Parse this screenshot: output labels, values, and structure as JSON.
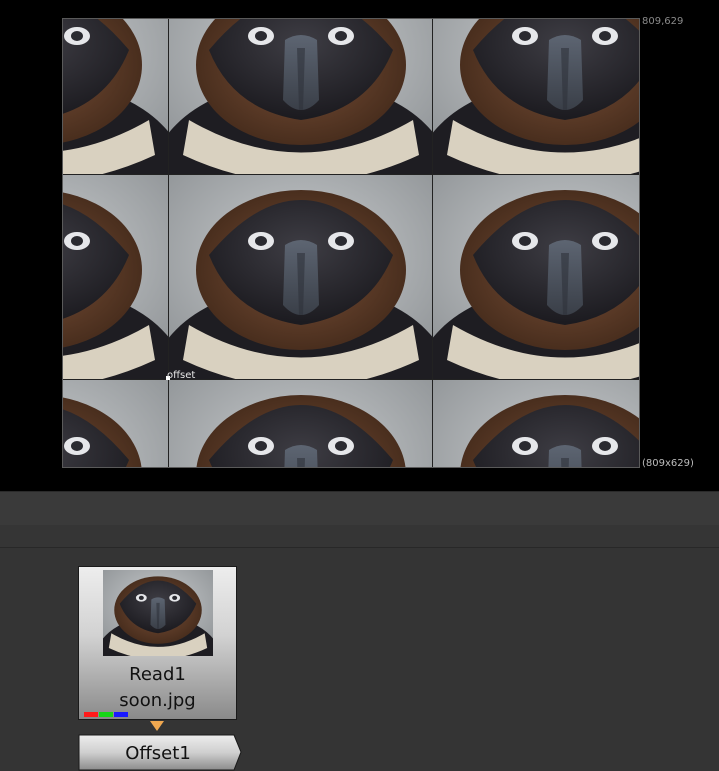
{
  "viewer": {
    "format_coords": "809,629",
    "format_size": "(809x629)",
    "overlay_label": "offset"
  },
  "node_graph": {
    "nodes": [
      {
        "name": "Read1",
        "file": "soon.jpg",
        "channels": {
          "red": "#ff1a1a",
          "green": "#17d617",
          "blue": "#1a1aff"
        }
      },
      {
        "name": "Offset1"
      }
    ],
    "pipe_arrow_color": "#f0a850"
  }
}
